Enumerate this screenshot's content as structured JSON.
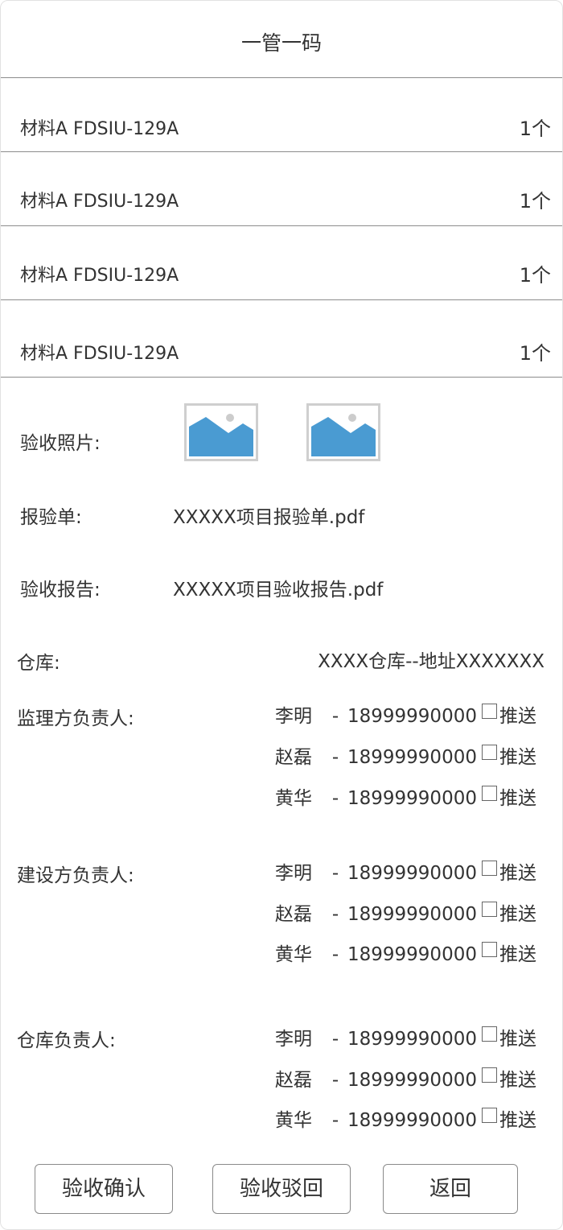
{
  "header": {
    "title": "一管一码"
  },
  "materials": [
    {
      "name": "材料A FDSIU-129A",
      "qty": "1个"
    },
    {
      "name": "材料A FDSIU-129A",
      "qty": "1个"
    },
    {
      "name": "材料A FDSIU-129A",
      "qty": "1个"
    },
    {
      "name": "材料A FDSIU-129A",
      "qty": "1个"
    }
  ],
  "photos": {
    "label": "验收照片:",
    "icon": "image-placeholder-icon"
  },
  "inspection_form": {
    "label": "报验单:",
    "file": "XXXXX项目报验单.pdf"
  },
  "acceptance_report": {
    "label": "验收报告:",
    "file": "XXXXX项目验收报告.pdf"
  },
  "warehouse": {
    "label": "仓库:",
    "value": "XXXX仓库--地址XXXXXXX"
  },
  "supervisor": {
    "label": "监理方负责人:",
    "people": [
      {
        "name": "李明",
        "dash": "-",
        "phone": "18999990000",
        "push": "推送"
      },
      {
        "name": "赵磊",
        "dash": "-",
        "phone": "18999990000",
        "push": "推送"
      },
      {
        "name": "黄华",
        "dash": "-",
        "phone": "18999990000",
        "push": "推送"
      }
    ]
  },
  "builder": {
    "label": "建设方负责人:",
    "people": [
      {
        "name": "李明",
        "dash": "-",
        "phone": "18999990000",
        "push": "推送"
      },
      {
        "name": "赵磊",
        "dash": "-",
        "phone": "18999990000",
        "push": "推送"
      },
      {
        "name": "黄华",
        "dash": "-",
        "phone": "18999990000",
        "push": "推送"
      }
    ]
  },
  "warehouse_manager": {
    "label": "仓库负责人:",
    "people": [
      {
        "name": "李明",
        "dash": "-",
        "phone": "18999990000",
        "push": "推送"
      },
      {
        "name": "赵磊",
        "dash": "-",
        "phone": "18999990000",
        "push": "推送"
      },
      {
        "name": "黄华",
        "dash": "-",
        "phone": "18999990000",
        "push": "推送"
      }
    ]
  },
  "actions": {
    "confirm": "验收确认",
    "reject": "验收驳回",
    "back": "返回"
  },
  "colors": {
    "image_sky": "#ffffff",
    "image_mountain": "#4a9bd2",
    "image_sun": "#cccccc",
    "divider": "#8c8c8c"
  }
}
